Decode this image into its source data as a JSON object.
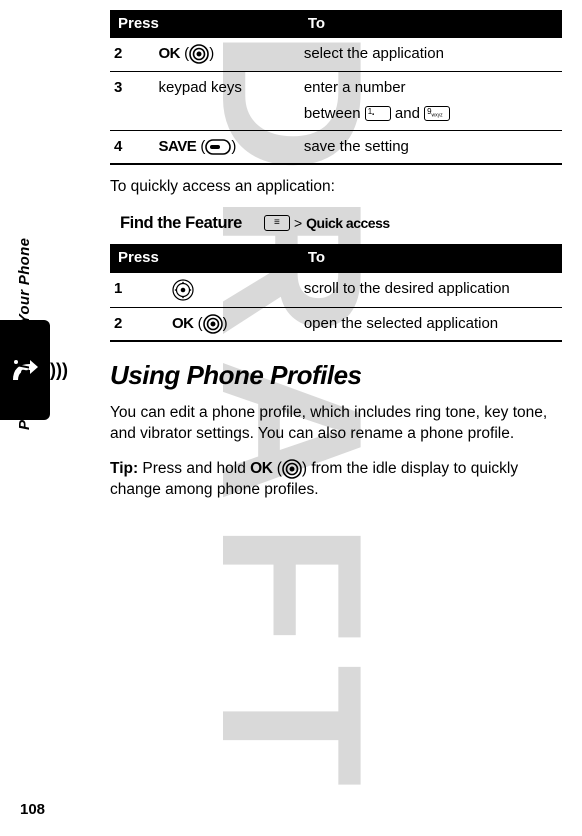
{
  "watermark": "DRAFT",
  "table1": {
    "headers": {
      "press": "Press",
      "to": "To"
    },
    "rows": [
      {
        "num": "2",
        "label": "OK",
        "to": "select the application"
      },
      {
        "num": "3",
        "press": "keypad keys",
        "to_line1": "enter a number",
        "to_line2_prefix": "between ",
        "to_line2_mid": " and "
      },
      {
        "num": "4",
        "label": "SAVE",
        "to": "save the setting"
      }
    ]
  },
  "body1": "To quickly access an application:",
  "find_feature": {
    "label": "Find the Feature",
    "separator": ">",
    "path": "Quick access"
  },
  "table2": {
    "headers": {
      "press": "Press",
      "to": "To"
    },
    "rows": [
      {
        "num": "1",
        "to": "scroll to the desired application"
      },
      {
        "num": "2",
        "label": "OK",
        "to": "open the selected application"
      }
    ]
  },
  "heading": "Using Phone Profiles",
  "body2": "You can edit a phone profile, which includes ring tone, key tone, and vibrator settings. You can also rename a phone profile.",
  "tip": {
    "lead": "Tip:",
    "before": " Press and hold ",
    "label": "OK",
    "after": " from the idle display to quickly change among phone profiles."
  },
  "side_label": "Personalizing Your Phone",
  "page_number": "108"
}
